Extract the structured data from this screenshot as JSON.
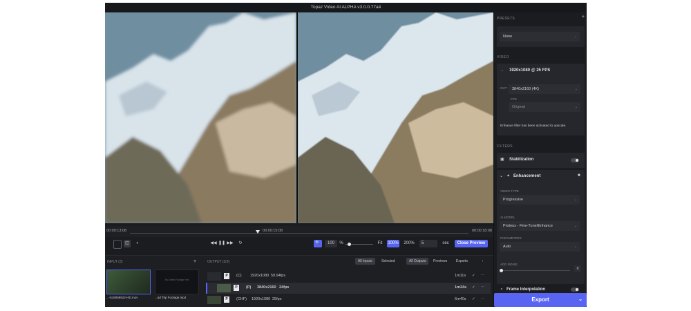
{
  "window": {
    "title": "Topaz Video AI ALPHA  v3.0.0.77a4"
  },
  "timeline": {
    "start": "00:00:13:08",
    "current": "00:00:15:08",
    "end": "00:00:18:08"
  },
  "controls": {
    "zoom_value": "100",
    "zoom_unit": "%",
    "fit_label": "Fit",
    "zoom_100": "100%",
    "zoom_200": "200%",
    "sec_value": "5",
    "sec_label": "sec",
    "close_preview": "Close Preview"
  },
  "input": {
    "header": "INPUT (3)",
    "add_glyph": "+",
    "items": [
      {
        "filename": "...-518069922-HD.mov"
      },
      {
        "filename": "...ad Trip Footage.mp4",
        "thumb_text": "No Video Footage Yet"
      }
    ]
  },
  "output": {
    "header": "OUTPUT (3/3)",
    "filter_tabs": [
      "All Inputs",
      "Selected"
    ],
    "view_tabs": [
      "All Outputs",
      "Previews",
      "Exports"
    ],
    "rows": [
      {
        "badge": "P",
        "model": "(C)",
        "res": "1920x1080",
        "fps": "59.94fps",
        "time": "1m11s"
      },
      {
        "badge": "P",
        "model": "(P)",
        "res": "3840x2160",
        "fps": "24fps",
        "time": "1m24s"
      },
      {
        "badge": "P",
        "model": "(CHF)",
        "res": "1920x1080",
        "fps": "25fps",
        "time": "6m40s"
      }
    ]
  },
  "sidebar": {
    "presets": {
      "title": "PRESETS",
      "add": "+",
      "value": "None"
    },
    "video": {
      "title": "VIDEO",
      "source": "1920x1080 @ 25 FPS",
      "out_label": "OUT",
      "resolution": "3840x2160 (4K)",
      "fps_label": "FPS",
      "fps_value": "Original",
      "note": "Enhance filter has been activated to upscale."
    },
    "filters": {
      "title": "FILTERS",
      "stabilization": "Stabilization",
      "enhancement": "Enhancement",
      "video_type_label": "VIDEO TYPE",
      "video_type": "Progressive",
      "ai_model_label": "AI MODEL",
      "ai_model": "Proteus - Fine-Tune/Enhance",
      "parameters_label": "PARAMETERS",
      "parameters": "Auto",
      "slider_label": "ADD NOISE",
      "slider_value": "0",
      "frame_interp": "Frame Interpolation"
    },
    "export_label": "Export"
  },
  "colors": {
    "accent": "#5865f2",
    "panel": "#1b1c20"
  }
}
